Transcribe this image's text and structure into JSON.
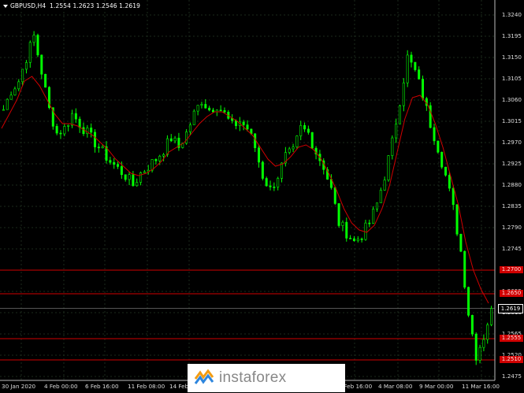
{
  "window": {
    "title": "GBPUSD,H4",
    "ohlc": "1.2554 1.2623 1.2546 1.2619"
  },
  "colors": {
    "background": "#000000",
    "grid": "#1e2a1e",
    "bull_candle": "#00ff00",
    "ma_line": "#d00000",
    "level_line": "#d00000",
    "axis_text": "#dddddd"
  },
  "price_axis": {
    "labels": [
      "1.3240",
      "1.3195",
      "1.3150",
      "1.3105",
      "1.3060",
      "1.3015",
      "1.2970",
      "1.2925",
      "1.2880",
      "1.2835",
      "1.2790",
      "1.2745",
      "1.2700",
      "1.2655",
      "1.2610",
      "1.2565",
      "1.2520",
      "1.2475"
    ],
    "current_price": "1.2619",
    "level_tags": [
      "1.2700",
      "1.2650",
      "1.2555",
      "1.2510"
    ]
  },
  "time_axis": {
    "labels": [
      "30 Jan 2020",
      "4 Feb 00:00",
      "6 Feb 16:00",
      "11 Feb 08:00",
      "14 Feb",
      "28 Feb 16:00",
      "4 Mar 08:00",
      "9 Mar 00:00",
      "11 Mar 16:00"
    ]
  },
  "watermark": {
    "text": "instaforex",
    "logo_icon": "instaforex-logo-icon"
  },
  "chart_data": {
    "type": "candlestick",
    "symbol": "GBPUSD",
    "timeframe": "H4",
    "ylim": [
      1.2475,
      1.3255
    ],
    "grid": true,
    "close_series": [
      1.304,
      1.308,
      1.31,
      1.315,
      1.3195,
      1.312,
      1.304,
      1.299,
      1.3,
      1.303,
      1.301,
      1.299,
      1.297,
      1.295,
      1.293,
      1.2915,
      1.29,
      1.288,
      1.2905,
      1.292,
      1.2935,
      1.2955,
      1.298,
      1.296,
      1.299,
      1.303,
      1.306,
      1.304,
      1.305,
      1.303,
      1.3005,
      1.3015,
      1.3,
      1.296,
      1.29,
      1.287,
      1.29,
      1.294,
      1.295,
      1.3,
      1.299,
      1.295,
      1.292,
      1.287,
      1.28,
      1.278,
      1.276,
      1.2775,
      1.28,
      1.284,
      1.29,
      1.297,
      1.306,
      1.315,
      1.312,
      1.307,
      1.301,
      1.296,
      1.29,
      1.283,
      1.274,
      1.261,
      1.252,
      1.256,
      1.2619
    ],
    "ma_series": [
      1.3,
      1.303,
      1.306,
      1.31,
      1.311,
      1.309,
      1.306,
      1.303,
      1.301,
      1.301,
      1.3005,
      1.2995,
      1.2985,
      1.297,
      1.2955,
      1.2935,
      1.292,
      1.2905,
      1.29,
      1.2905,
      1.2915,
      1.293,
      1.295,
      1.296,
      1.297,
      1.299,
      1.301,
      1.3025,
      1.3035,
      1.3035,
      1.3025,
      1.3015,
      1.3,
      1.2985,
      1.296,
      1.2935,
      1.292,
      1.2925,
      1.294,
      1.296,
      1.2965,
      1.2955,
      1.2935,
      1.2905,
      1.287,
      1.283,
      1.28,
      1.2785,
      1.278,
      1.2795,
      1.283,
      1.288,
      1.295,
      1.302,
      1.3065,
      1.307,
      1.305,
      1.301,
      1.296,
      1.29,
      1.284,
      1.276,
      1.27,
      1.266,
      1.263
    ],
    "horizontal_levels": [
      1.27,
      1.265,
      1.2555,
      1.251
    ]
  }
}
